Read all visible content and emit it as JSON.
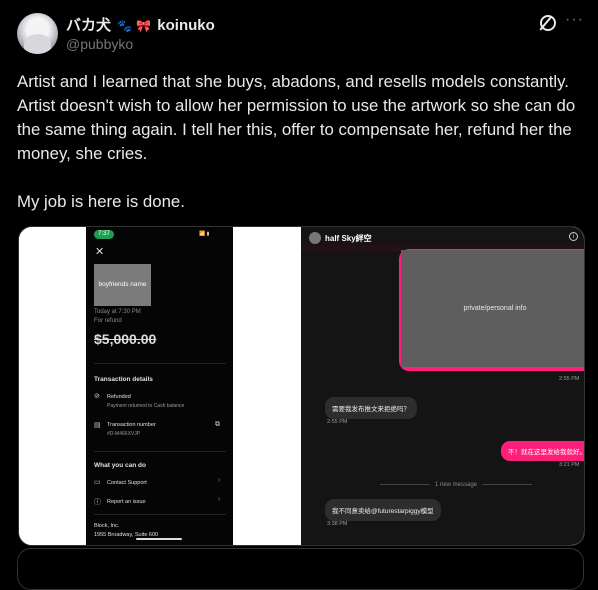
{
  "post": {
    "display_name": "バカ犬",
    "emoji_paw": "🐾",
    "emoji_bow": "🎀",
    "display_name_suffix": "koinuko",
    "handle": "@pubbyko",
    "more_label": "···",
    "text_paragraph_1": "Artist and I learned that she buys, abadons, and resells models constantly. Artist doesn't wish to allow her permission to use the artwork so she can do the same thing again. I tell her this, offer to compensate her, refund her the money, she cries.",
    "text_paragraph_2": "My job is here is done."
  },
  "phone": {
    "time": "7:37",
    "status": "📶 ▮",
    "close": "✕",
    "photo_label": "boyfriends name",
    "date": "Today at 7:30 PM",
    "for": "For refund",
    "amount": "$5,000.00",
    "transaction_header": "Transaction details",
    "refunded_label": "Refunded",
    "refunded_sub": "Payment returned to Cash balance",
    "txn_label": "Transaction number",
    "txn_value": "#D-M466XVJP",
    "what_header": "What you can do",
    "contact_support": "Contact Support",
    "report_issue": "Report an issue",
    "company": "Block, Inc.",
    "address": "1955 Broadway, Suite 600"
  },
  "chat": {
    "contact_name": "half Sky絆空",
    "info_icon": "i",
    "private_label": "private/personal info",
    "ts_1": "2:55 PM",
    "msg_1": "需要我发布推文来拒绝吗？",
    "ts_2": "2:55 PM",
    "msg_2": "不！就在这里发给我就好。",
    "ts_3": "3:21 PM",
    "new_message": "1 new message",
    "msg_3": "我不同意卖给@futurestarpiggy模型",
    "ts_4": "3:38 PM"
  },
  "colors": {
    "accent_pink": "#ff1f7a",
    "cash_green": "#1d9d52",
    "text_primary": "#e7e9ea",
    "text_secondary": "#71767b"
  }
}
